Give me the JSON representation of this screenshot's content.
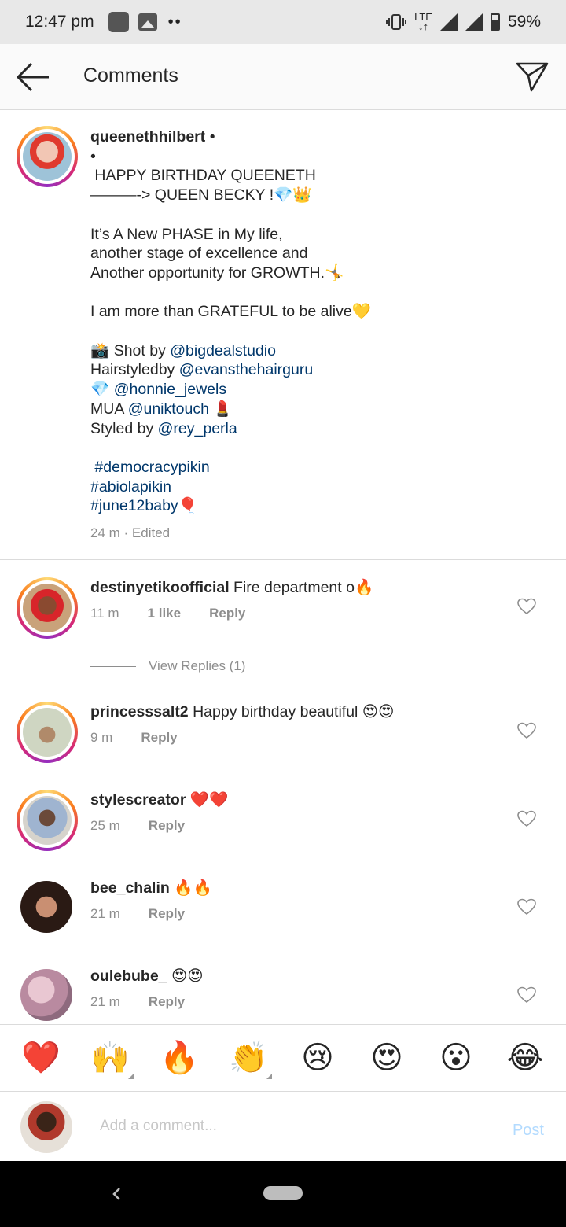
{
  "status_bar": {
    "time": "12:47 pm",
    "network": "LTE",
    "battery": "59%"
  },
  "header": {
    "title": "Comments"
  },
  "post": {
    "username": "queenethhilbert",
    "separator": "•",
    "caption_lines": [
      "•",
      " HAPPY BIRTHDAY QUEENETH",
      "———-> QUEEN BECKY !💎👑",
      "",
      "It’s A New PHASE in My life,",
      "another stage of excellence and",
      "Another opportunity for GROWTH.🤸",
      "",
      "I am more than GRATEFUL to be alive💛",
      ""
    ],
    "credits": [
      {
        "prefix": "📸 Shot by ",
        "mention": "@bigdealstudio",
        "suffix": ""
      },
      {
        "prefix": "Hairstyledby ",
        "mention": "@evansthehairguru",
        "suffix": ""
      },
      {
        "prefix": "💎 ",
        "mention": "@honnie_jewels",
        "suffix": ""
      },
      {
        "prefix": "MUA ",
        "mention": "@uniktouch",
        "suffix": " 💄"
      },
      {
        "prefix": "Styled by ",
        "mention": "@rey_perla",
        "suffix": ""
      }
    ],
    "hashtags": [
      {
        "tag": " #democracypikin",
        "suffix": ""
      },
      {
        "tag": "#abiolapikin",
        "suffix": ""
      },
      {
        "tag": "#june12baby",
        "suffix": "🎈"
      }
    ],
    "meta": "24 m · Edited"
  },
  "comments": [
    {
      "username": "destinyetikoofficial",
      "text": "Fire department o🔥",
      "time": "11 m",
      "likes": "1 like",
      "reply": "Reply"
    },
    {
      "username": "princesssalt2",
      "text": "Happy birthday beautiful 😍😍",
      "time": "9 m",
      "likes": "",
      "reply": "Reply"
    },
    {
      "username": "stylescreator",
      "text": "❤️❤️",
      "time": "25 m",
      "likes": "",
      "reply": "Reply"
    },
    {
      "username": "bee_chalin",
      "text": "🔥🔥",
      "time": "21 m",
      "likes": "",
      "reply": "Reply"
    },
    {
      "username": "oulebube_",
      "text": "😍😍",
      "time": "21 m",
      "likes": "",
      "reply": "Reply"
    }
  ],
  "view_replies": "View Replies (1)",
  "emoji_bar": [
    "❤️",
    "🙌",
    "🔥",
    "👏",
    "😢",
    "😍",
    "😮",
    "😂"
  ],
  "input": {
    "placeholder": "Add a comment...",
    "post_label": "Post"
  },
  "colors": {
    "link": "#00376b",
    "meta": "#8e8e8e",
    "post_disabled": "#b3dbff"
  }
}
